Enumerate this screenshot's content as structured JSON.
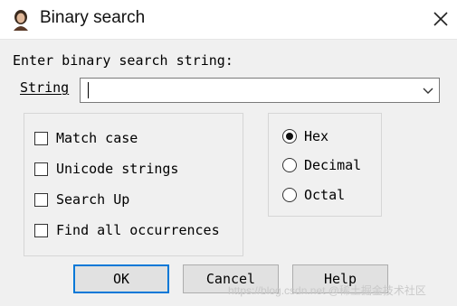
{
  "window": {
    "title": "Binary search",
    "icon": "app-portrait-icon"
  },
  "form": {
    "prompt": "Enter binary search string:",
    "string_label": "String",
    "string_value": ""
  },
  "options": {
    "checkboxes": [
      {
        "label": "Match case",
        "checked": false
      },
      {
        "label": "Unicode strings",
        "checked": false
      },
      {
        "label": "Search Up",
        "checked": false
      },
      {
        "label": "Find all occurrences",
        "checked": false
      }
    ],
    "radios": [
      {
        "label": "Hex",
        "selected": true
      },
      {
        "label": "Decimal",
        "selected": false
      },
      {
        "label": "Octal",
        "selected": false
      }
    ]
  },
  "buttons": {
    "ok": "OK",
    "cancel": "Cancel",
    "help": "Help"
  },
  "watermark": "https://blog.csdn.net @稀土掘金技术社区",
  "colors": {
    "default_button_border": "#0078d7",
    "background": "#f0f0f0"
  }
}
